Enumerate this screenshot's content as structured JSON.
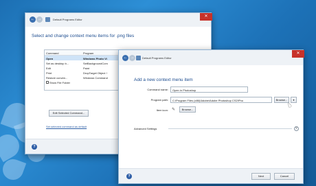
{
  "back_window": {
    "title": "Default Programs Editor",
    "heading": "Select and change context menu items for .png files",
    "table": {
      "columns": [
        "Command",
        "Program"
      ],
      "rows": [
        {
          "command": "Open",
          "program": "Windows Photo Vi",
          "selected": true,
          "checkbox": false
        },
        {
          "command": "Set as desktop b...",
          "program": "SetBackgroundCom",
          "selected": false,
          "checkbox": false
        },
        {
          "command": "Edit",
          "program": "Paint",
          "selected": false,
          "checkbox": false
        },
        {
          "command": "Print",
          "program": "DropTarget Object !",
          "selected": false,
          "checkbox": false
        },
        {
          "command": "Restore conven...",
          "program": "Windows Command",
          "selected": false,
          "checkbox": false
        },
        {
          "command": "Show File Folder",
          "program": "",
          "selected": false,
          "checkbox": true
        }
      ]
    },
    "edit_button": "Edit Selected Command...",
    "default_link": "Set selected command as default",
    "help_icon": "?"
  },
  "front_window": {
    "title": "Default Programs Editor",
    "heading": "Add a new context menu item",
    "command_name_label": "Command name:",
    "command_name_value": "Open in Photoshop",
    "program_path_label": "Program path:",
    "program_path_value": "C:\\Program Files (x86)\\Adobe\\Adobe Photoshop CS2\\Pho",
    "browse_label": "Browse...",
    "dropdown_arrow": "▾",
    "item_icon_label": "Item icon:",
    "item_icon_symbol": "✎",
    "icon_browse_label": "Browse...",
    "advanced_label": "Advanced Settings",
    "advanced_toggle": "˅",
    "help_icon": "?",
    "next_label": "Next",
    "cancel_label": "Cancel"
  },
  "icons": {
    "close": "✕",
    "back": "←",
    "forward": "→"
  },
  "colors": {
    "desktop": "#1d72b8",
    "close_button": "#c7322a",
    "heading_text": "#1c4c8f",
    "selection": "#cfe3f7"
  }
}
